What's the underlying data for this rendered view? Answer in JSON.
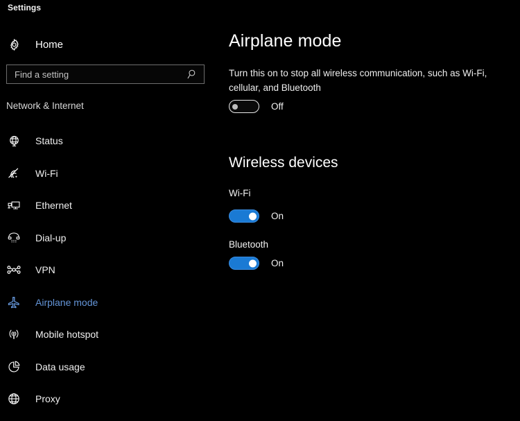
{
  "window": {
    "title": "Settings"
  },
  "sidebar": {
    "home": {
      "label": "Home",
      "icon": "gear-icon"
    },
    "search": {
      "placeholder": "Find a setting",
      "value": "",
      "icon": "search-icon"
    },
    "category_label": "Network & Internet",
    "items": [
      {
        "label": "Status",
        "icon": "globe-status-icon",
        "selected": false
      },
      {
        "label": "Wi-Fi",
        "icon": "wifi-icon",
        "selected": false
      },
      {
        "label": "Ethernet",
        "icon": "ethernet-icon",
        "selected": false
      },
      {
        "label": "Dial-up",
        "icon": "telephone-icon",
        "selected": false
      },
      {
        "label": "VPN",
        "icon": "vpn-icon",
        "selected": false
      },
      {
        "label": "Airplane mode",
        "icon": "airplane-icon",
        "selected": true
      },
      {
        "label": "Mobile hotspot",
        "icon": "hotspot-icon",
        "selected": false
      },
      {
        "label": "Data usage",
        "icon": "pie-chart-icon",
        "selected": false
      },
      {
        "label": "Proxy",
        "icon": "globe-icon",
        "selected": false
      }
    ]
  },
  "main": {
    "title": "Airplane mode",
    "description": "Turn this on to stop all wireless communication, such as Wi-Fi, cellular, and Bluetooth",
    "airplane_toggle": {
      "state_label": "Off",
      "on": false
    },
    "wireless_heading": "Wireless devices",
    "devices": [
      {
        "name": "Wi-Fi",
        "state_label": "On",
        "on": true
      },
      {
        "name": "Bluetooth",
        "state_label": "On",
        "on": true
      }
    ]
  },
  "colors": {
    "background": "#000000",
    "accent": "#6495d8",
    "toggle_on": "#1a7ad4",
    "text_primary": "#ffffff",
    "text_secondary": "#d8d8d8",
    "border": "#6e6e6e"
  }
}
